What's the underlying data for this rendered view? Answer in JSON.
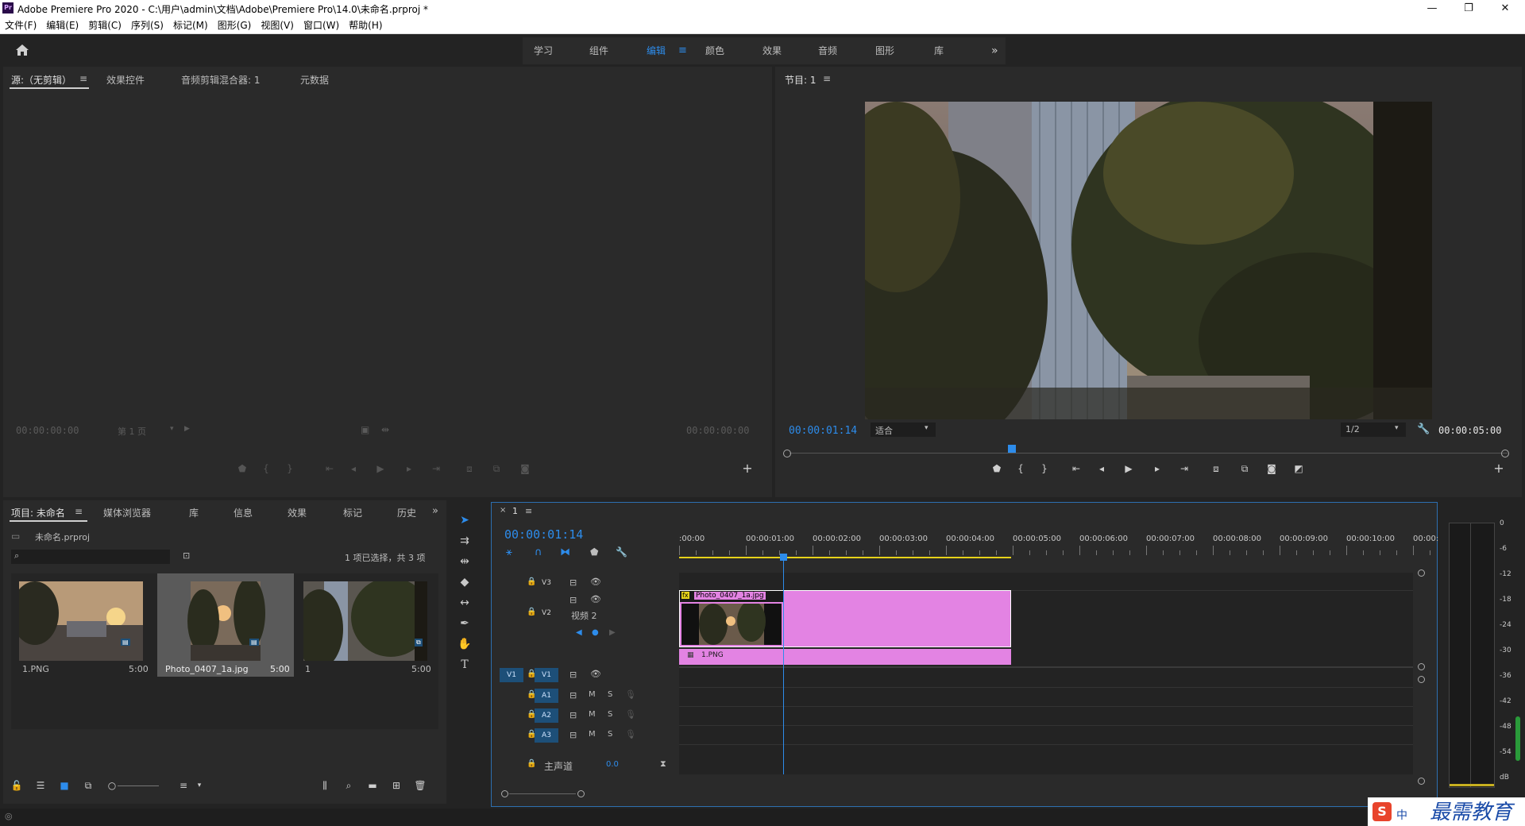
{
  "window": {
    "title": "Adobe Premiere Pro 2020 - C:\\用户\\admin\\文档\\Adobe\\Premiere Pro\\14.0\\未命名.prproj *",
    "app_icon_text": "Pr",
    "minimize": "—",
    "maximize": "❐",
    "close": "✕"
  },
  "menu": [
    "文件(F)",
    "编辑(E)",
    "剪辑(C)",
    "序列(S)",
    "标记(M)",
    "图形(G)",
    "视图(V)",
    "窗口(W)",
    "帮助(H)"
  ],
  "workspaces": {
    "tabs": [
      "学习",
      "组件",
      "编辑",
      "颜色",
      "效果",
      "音频",
      "图形",
      "库"
    ],
    "active": "编辑",
    "more": "»"
  },
  "source_panel": {
    "tabs": [
      "源:（无剪辑）",
      "效果控件",
      "音频剪辑混合器: 1",
      "元数据"
    ],
    "timecode_left": "00:00:00:00",
    "page_select": "第 1 页",
    "timecode_right": "00:00:00:00"
  },
  "program_panel": {
    "title": "节目: 1",
    "timecode": "00:00:01:14",
    "fit": "适合",
    "resolution": "1/2",
    "duration": "00:00:05:00",
    "playhead_fraction": 0.31
  },
  "project_panel": {
    "tabs": [
      "项目: 未命名",
      "媒体浏览器",
      "库",
      "信息",
      "效果",
      "标记",
      "历史"
    ],
    "project_file": "未命名.prproj",
    "search_placeholder": "",
    "selection_info": "1 项已选择，共 3 项",
    "items": [
      {
        "name": "1.PNG",
        "duration": "5:00"
      },
      {
        "name": "Photo_0407_1a.jpg",
        "duration": "5:00"
      },
      {
        "name": "1",
        "duration": "5:00"
      }
    ]
  },
  "timeline": {
    "sequence_name": "1",
    "timecode": "00:00:01:14",
    "ruler": [
      ":00:00",
      "00:00:01:00",
      "00:00:02:00",
      "00:00:03:00",
      "00:00:04:00",
      "00:00:05:00",
      "00:00:06:00",
      "00:00:07:00",
      "00:00:08:00",
      "00:00:09:00",
      "00:00:10:00",
      "00:00:1"
    ],
    "tracks": {
      "v3": "V3",
      "v2": "V2",
      "v2_name": "视频 2",
      "v1": "V1",
      "v1_src": "V1",
      "a1": "A1",
      "a2": "A2",
      "a3": "A3",
      "mute": "M",
      "solo": "S",
      "master": "主声道",
      "master_value": "0.0"
    },
    "clips": {
      "v2_clip": "Photo_0407_1a.jpg",
      "v1_clip": "1.PNG",
      "fx_badge": "fx"
    }
  },
  "audio_meter": {
    "scale": [
      "0",
      "-6",
      "-12",
      "-18",
      "-24",
      "-30",
      "-36",
      "-42",
      "-48",
      "-54",
      "dB"
    ]
  },
  "watermark": {
    "text": "最需教育",
    "ime": "中"
  },
  "colors": {
    "accent_blue": "#2d8ceb",
    "clip_pink": "#e383e3",
    "work_area_yellow": "#e6d21a",
    "panel_bg": "#2a2a2a"
  }
}
